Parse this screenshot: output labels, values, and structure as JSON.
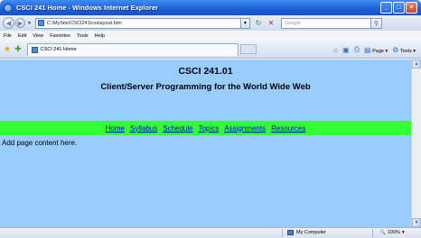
{
  "window": {
    "title": "CSCI 241 Home - Windows Internet Explorer"
  },
  "address": {
    "url": "C:\\MySite\\CSCI241\\csslayout.htm",
    "search_placeholder": "Google"
  },
  "menu": [
    "File",
    "Edit",
    "View",
    "Favorites",
    "Tools",
    "Help"
  ],
  "tab": {
    "label": "CSCI 241 Home"
  },
  "command_bar": {
    "page_label": "Page",
    "tools_label": "Tools"
  },
  "page": {
    "title": "CSCI 241.01",
    "subtitle": "Client/Server Programming for the World Wide Web",
    "nav": [
      "Home",
      "Syllabus",
      "Schedule",
      "Topics",
      "Assignments",
      "Resources"
    ],
    "body_text": "Add page content here."
  },
  "status": {
    "zone": "My Computer",
    "zoom": "100%"
  },
  "colors": {
    "content_bg": "#99ccff",
    "nav_bg": "#33ff33",
    "link": "#0000ee"
  }
}
